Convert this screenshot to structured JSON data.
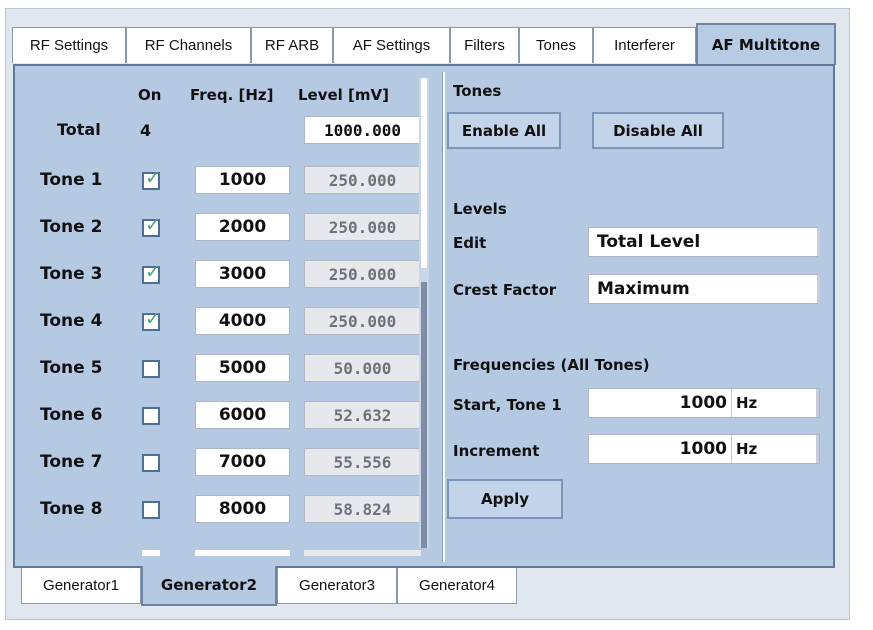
{
  "tabs": [
    "RF Settings",
    "RF Channels",
    "RF ARB",
    "AF Settings",
    "Filters",
    "Tones",
    "Interferer",
    "AF Multitone"
  ],
  "active_tab": "AF Multitone",
  "table": {
    "headers": {
      "on": "On",
      "freq": "Freq. [Hz]",
      "level": "Level [mV]"
    },
    "total": {
      "label": "Total",
      "count": "4",
      "level": "1000.000"
    },
    "tones": [
      {
        "label": "Tone 1",
        "on": true,
        "freq": "1000",
        "level": "250.000"
      },
      {
        "label": "Tone 2",
        "on": true,
        "freq": "2000",
        "level": "250.000"
      },
      {
        "label": "Tone 3",
        "on": true,
        "freq": "3000",
        "level": "250.000"
      },
      {
        "label": "Tone 4",
        "on": true,
        "freq": "4000",
        "level": "250.000"
      },
      {
        "label": "Tone 5",
        "on": false,
        "freq": "5000",
        "level": "50.000"
      },
      {
        "label": "Tone 6",
        "on": false,
        "freq": "6000",
        "level": "52.632"
      },
      {
        "label": "Tone 7",
        "on": false,
        "freq": "7000",
        "level": "55.556"
      },
      {
        "label": "Tone 8",
        "on": false,
        "freq": "8000",
        "level": "58.824"
      }
    ]
  },
  "tones_section": {
    "title": "Tones",
    "enable_all": "Enable All",
    "disable_all": "Disable All"
  },
  "levels_section": {
    "title": "Levels",
    "edit_label": "Edit",
    "edit_value": "Total Level",
    "crest_label": "Crest Factor",
    "crest_value": "Maximum"
  },
  "frequencies_section": {
    "title": "Frequencies (All Tones)",
    "start_label": "Start, Tone 1",
    "start_value": "1000",
    "start_unit": "Hz",
    "increment_label": "Increment",
    "increment_value": "1000",
    "increment_unit": "Hz",
    "apply": "Apply"
  },
  "generators": [
    "Generator1",
    "Generator2",
    "Generator3",
    "Generator4"
  ],
  "active_generator": "Generator2",
  "check_glyph": "✓",
  "colors": {
    "panel": "#b6c9e3",
    "check": "#4aa57e",
    "border": "#5f7898"
  }
}
